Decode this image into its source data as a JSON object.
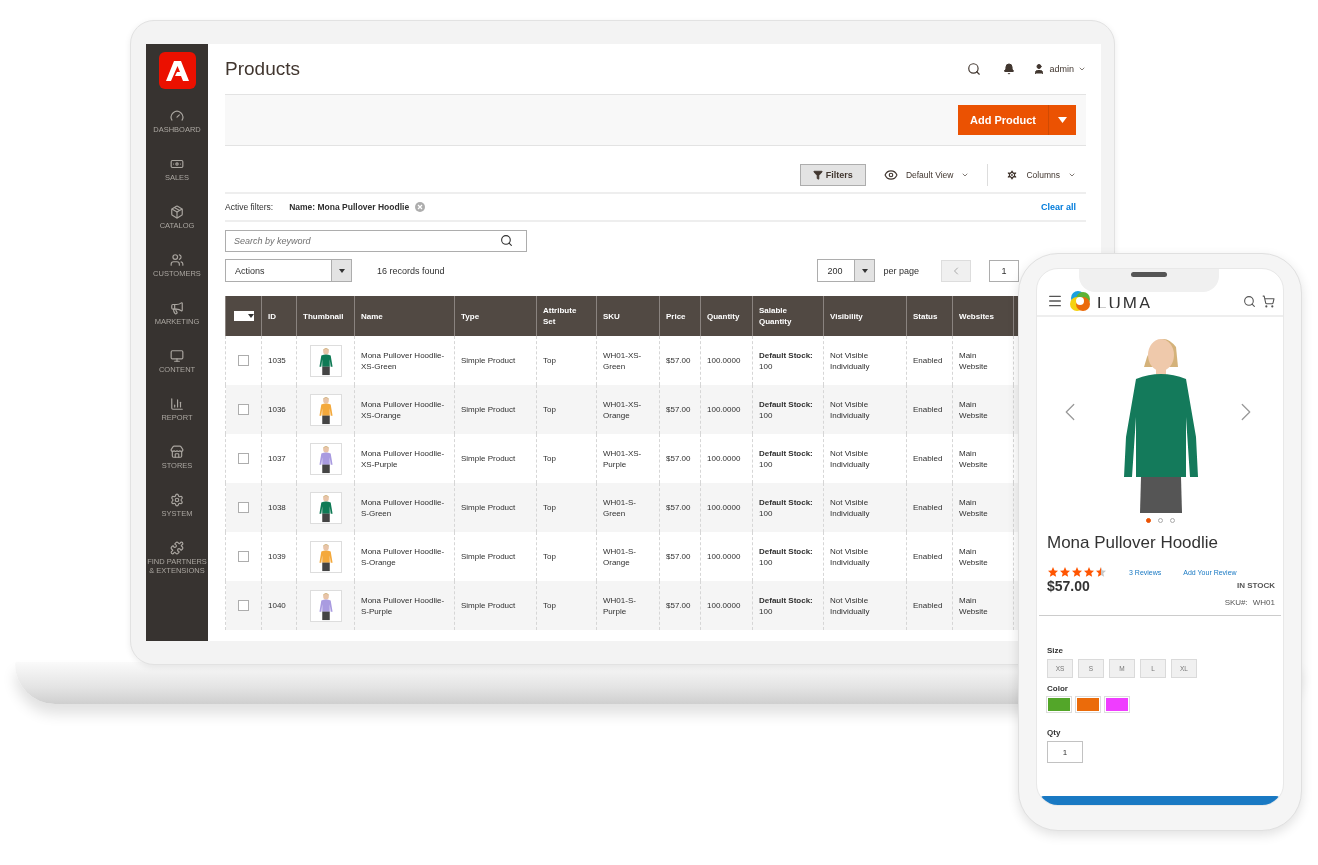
{
  "admin": {
    "title": "Products",
    "user": "admin",
    "sidebar": [
      {
        "label": "DASHBOARD"
      },
      {
        "label": "SALES"
      },
      {
        "label": "CATALOG"
      },
      {
        "label": "CUSTOMERS"
      },
      {
        "label": "MARKETING"
      },
      {
        "label": "CONTENT"
      },
      {
        "label": "REPORT"
      },
      {
        "label": "STORES"
      },
      {
        "label": "SYSTEM"
      },
      {
        "label": "FIND PARTNERS & EXTENSIONS"
      }
    ],
    "add_button": "Add Product",
    "toolbar": {
      "filters": "Filters",
      "view": "Default View",
      "columns": "Columns"
    },
    "active_filters": {
      "label": "Active filters:",
      "filter": "Name: Mona Pullover Hoodlie",
      "clear": "Clear all"
    },
    "search": {
      "placeholder": "Search by keyword"
    },
    "actions": "Actions",
    "records": "16 records found",
    "pager": {
      "per_page_value": "200",
      "per_page_label": "per page",
      "page": "1"
    },
    "table": {
      "select_all_checked": false,
      "columns": [
        "ID",
        "Thumbnail",
        "Name",
        "Type",
        "Attribute Set",
        "SKU",
        "Price",
        "Quantity",
        "Salable Quantity",
        "Visibility",
        "Status",
        "Websites"
      ],
      "rows": [
        {
          "checked": false,
          "id": "1035",
          "name": "Mona Pullover Hoodlie-XS-Green",
          "type": "Simple Product",
          "attribute_set": "Top",
          "sku": "WH01-XS-Green",
          "price": "$57.00",
          "quantity": "100.0000",
          "salable": "**Default Stock:** 100",
          "visibility": "Not Visible Individually",
          "status": "Enabled",
          "websites": "Main Website"
        },
        {
          "checked": false,
          "id": "1036",
          "name": "Mona Pullover Hoodlie-XS-Orange",
          "type": "Simple Product",
          "attribute_set": "Top",
          "sku": "WH01-XS-Orange",
          "price": "$57.00",
          "quantity": "100.0000",
          "salable": "**Default Stock:** 100",
          "visibility": "Not Visible Individually",
          "status": "Enabled",
          "websites": "Main Website"
        },
        {
          "checked": false,
          "id": "1037",
          "name": "Mona Pullover Hoodlie-XS-Purple",
          "type": "Simple Product",
          "attribute_set": "Top",
          "sku": "WH01-XS-Purple",
          "price": "$57.00",
          "quantity": "100.0000",
          "salable": "**Default Stock:** 100",
          "visibility": "Not Visible Individually",
          "status": "Enabled",
          "websites": "Main Website"
        },
        {
          "checked": false,
          "id": "1038",
          "name": "Mona Pullover Hoodlie-S-Green",
          "type": "Simple Product",
          "attribute_set": "Top",
          "sku": "WH01-S-Green",
          "price": "$57.00",
          "quantity": "100.0000",
          "salable": "**Default Stock:** 100",
          "visibility": "Not Visible Individually",
          "status": "Enabled",
          "websites": "Main Website"
        },
        {
          "checked": false,
          "id": "1039",
          "name": "Mona Pullover Hoodlie-S-Orange",
          "type": "Simple Product",
          "attribute_set": "Top",
          "sku": "WH01-S-Orange",
          "price": "$57.00",
          "quantity": "100.0000",
          "salable": "**Default Stock:** 100",
          "visibility": "Not Visible Individually",
          "status": "Enabled",
          "websites": "Main Website"
        },
        {
          "checked": false,
          "id": "1040",
          "name": "Mona Pullover Hoodlie-S-Purple",
          "type": "Simple Product",
          "attribute_set": "Top",
          "sku": "WH01-S-Purple",
          "price": "$57.00",
          "quantity": "100.0000",
          "salable": "**Default Stock:** 100",
          "visibility": "Not Visible Individually",
          "status": "Enabled",
          "websites": "Main Website"
        }
      ]
    }
  },
  "store": {
    "logo": "LUMA",
    "slides": [
      {
        "selected": true
      },
      {
        "selected": false
      },
      {
        "selected": false
      }
    ],
    "product": {
      "name": "Mona Pullover Hoodlie",
      "stars": 4.5,
      "reviews": "3  Reviews",
      "add_review": "Add Your Review",
      "price": "$57.00",
      "stock": "IN STOCK",
      "sku_label": "SKU#:",
      "sku": "WH01"
    },
    "size_label": "Size",
    "sizes": [
      "XS",
      "S",
      "M",
      "L",
      "XL"
    ],
    "color_label": "Color",
    "colors": [
      {
        "color": "#53a629"
      },
      {
        "color": "#eb6b0a"
      },
      {
        "color": "#ef3dff"
      }
    ],
    "qty_label": "Qty",
    "qty": "1"
  }
}
